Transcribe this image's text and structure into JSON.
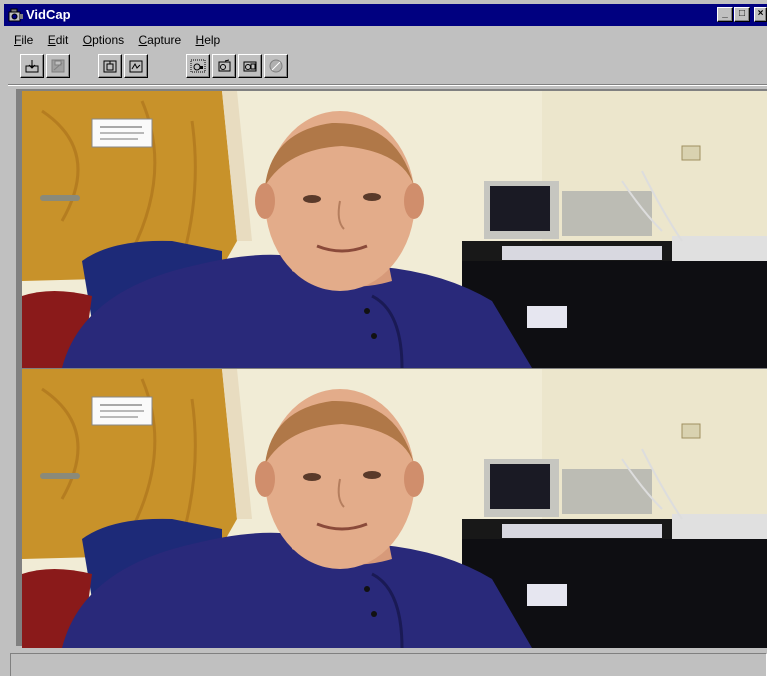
{
  "window": {
    "title": "VidCap"
  },
  "titlebar_buttons": {
    "minimize": "_",
    "maximize": "□",
    "close": "×"
  },
  "menu": [
    {
      "label": "File",
      "accel": "F",
      "rest": "ile"
    },
    {
      "label": "Edit",
      "accel": "E",
      "rest": "dit"
    },
    {
      "label": "Options",
      "accel": "O",
      "rest": "ptions"
    },
    {
      "label": "Capture",
      "accel": "C",
      "rest": "apture"
    },
    {
      "label": "Help",
      "accel": "H",
      "rest": "elp"
    }
  ],
  "toolbar": {
    "buttons": [
      {
        "name": "set-capture-file-icon"
      },
      {
        "name": "save-captured-video-icon"
      },
      {
        "name": "video-source-icon"
      },
      {
        "name": "video-format-icon"
      },
      {
        "name": "capture-single-frame-icon"
      },
      {
        "name": "capture-frames-icon"
      },
      {
        "name": "capture-video-icon"
      },
      {
        "name": "stop-capture-icon"
      }
    ]
  },
  "preview": {
    "frames": [
      "top-video-frame",
      "bottom-video-frame"
    ]
  },
  "status": {
    "text": ""
  },
  "colors": {
    "titlebar": "#000080",
    "face": "#c0c0c0",
    "shirt": "#2a2a70",
    "door": "#c8922a"
  }
}
